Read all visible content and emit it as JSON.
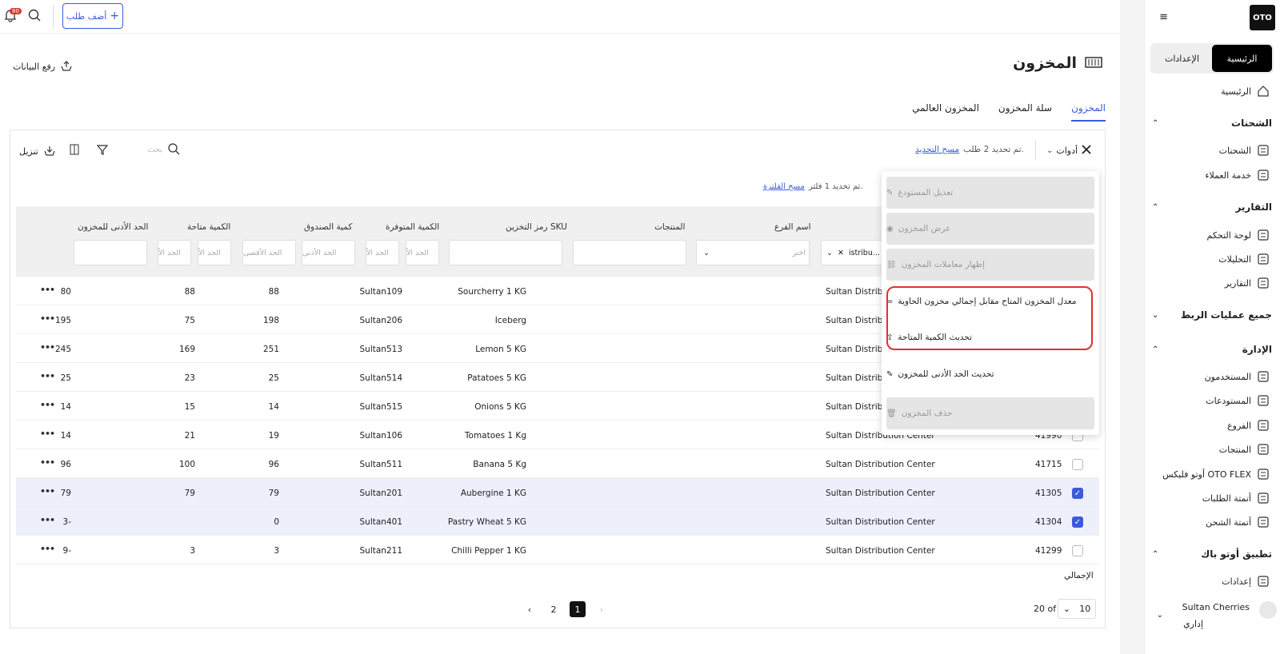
{
  "sidebar": {
    "logo": "OTO",
    "tabs": {
      "home": "الرئيسية",
      "settings": "الإعدادات"
    },
    "home_item": "الرئيسية",
    "sections": [
      {
        "title": "الشحنات",
        "items": [
          "الشحنات",
          "خدمة العملاء"
        ]
      },
      {
        "title": "التقارير",
        "items": [
          "لوحة التحكم",
          "التحليلات",
          "التقارير"
        ]
      },
      {
        "title": "جميع عمليات الربط",
        "items": []
      },
      {
        "title": "الإدارة",
        "items": [
          "المستخدمون",
          "المستودعات",
          "الفروع",
          "المنتجات",
          "أوتو فليكس OTO FLEX",
          "أتمتة الطلبات",
          "أتمتة الشحن"
        ]
      },
      {
        "title": "تطبيق أوتو باك",
        "items": [
          "إعدادات"
        ]
      }
    ],
    "user": {
      "name": "Sultan Cherries",
      "role": "إداري"
    }
  },
  "topbar": {
    "add_order": "أضف طلب",
    "notif_count": "80"
  },
  "page": {
    "title": "المخزون",
    "upload": "رفع البيانات"
  },
  "tabs": [
    "المخزون",
    "سلة المخزون",
    "المخزون العالمي"
  ],
  "toolbar": {
    "tools": "أدوات",
    "selected_info": "تم تحديد 2 طلب.",
    "clear_selection": "مسح التحديد",
    "search_placeholder": "بحث",
    "download": "تنزيل",
    "filter_info": "تم تحديد 1 فلتر.",
    "clear_filter": "مسح الفلترة"
  },
  "columns": {
    "branch": "اسم الفرع",
    "products": "المنتجات",
    "sku": "رمز التخزين SKU",
    "available_qty": "الكمية المتوفرة",
    "box_qty": "كمية الصندوق",
    "qty_avail": "الكمية متاحة",
    "min_stock": "الحد الأدنى للمخزون"
  },
  "filters": {
    "warehouse_value": "istribu...",
    "choose": "اختر",
    "min": "الحد الأ",
    "min_full": "الحد الأدنى",
    "max_full": "الحد الأقصى"
  },
  "rows": [
    {
      "id": "",
      "branch": "Sultan Distrib",
      "product": "Sourcherry 1 KG",
      "sku": "Sultan109",
      "available": "88",
      "box": "88",
      "qty": "80",
      "checked": false
    },
    {
      "id": "",
      "branch": "Sultan Distrib",
      "product": "Iceberg",
      "sku": "Sultan206",
      "available": "198",
      "box": "75",
      "qty": "195",
      "checked": false
    },
    {
      "id": "",
      "branch": "Sultan Distrib",
      "product": "Lemon 5 KG",
      "sku": "Sultan513",
      "available": "251",
      "box": "169",
      "qty": "245",
      "checked": false
    },
    {
      "id": "",
      "branch": "Sultan Distrib",
      "product": "Patatoes 5 KG",
      "sku": "Sultan514",
      "available": "25",
      "box": "23",
      "qty": "25",
      "checked": false
    },
    {
      "id": "",
      "branch": "Sultan Distrib",
      "product": "Onions 5 KG",
      "sku": "Sultan515",
      "available": "14",
      "box": "15",
      "qty": "14",
      "checked": false
    },
    {
      "id": "41990",
      "branch": "Sultan Distribution Center",
      "product": "Tomatoes 1 Kg",
      "sku": "Sultan106",
      "available": "19",
      "box": "21",
      "qty": "14",
      "checked": false
    },
    {
      "id": "41715",
      "branch": "Sultan Distribution Center",
      "product": "Banana 5 Kg",
      "sku": "Sultan511",
      "available": "96",
      "box": "100",
      "qty": "96",
      "checked": false
    },
    {
      "id": "41305",
      "branch": "Sultan Distribution Center",
      "product": "Aubergine 1 KG",
      "sku": "Sultan201",
      "available": "79",
      "box": "79",
      "qty": "79",
      "checked": true
    },
    {
      "id": "41304",
      "branch": "Sultan Distribution Center",
      "product": "Pastry Wheat 5 KG",
      "sku": "Sultan401",
      "available": "0",
      "box": "",
      "qty": "3-",
      "checked": true
    },
    {
      "id": "41299",
      "branch": "Sultan Distribution Center",
      "product": "Chilli Pepper 1 KG",
      "sku": "Sultan211",
      "available": "3",
      "box": "3",
      "qty": "9-",
      "checked": false
    }
  ],
  "total_label": "الإجمالي",
  "menu": [
    {
      "label": "تعديل المستودع",
      "disabled": true
    },
    {
      "label": "عرض المخزون",
      "disabled": true
    },
    {
      "label": "إظهار معاملات المخزون",
      "disabled": true
    },
    {
      "label": "معدل المخزون المتاح مقابل إجمالي مخزون الحاوية",
      "disabled": false
    },
    {
      "label": "تحديث الكمية المتاحة",
      "disabled": false
    },
    {
      "label": "تحديث الحد الأدنى للمخزون",
      "disabled": false
    },
    {
      "label": "حذف المخزون",
      "disabled": true
    }
  ],
  "pagination": {
    "pages": [
      "2",
      "1"
    ],
    "per_page": "10",
    "total": "20 of"
  },
  "colors": {
    "accent": "#3b5bdb",
    "highlight": "#e03131"
  }
}
